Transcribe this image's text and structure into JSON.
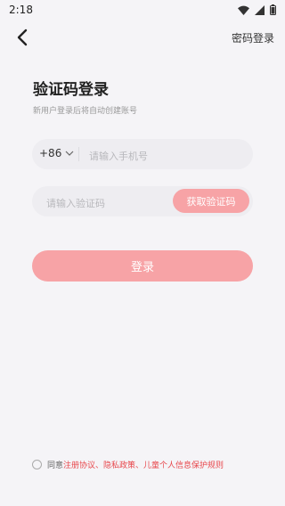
{
  "status": {
    "time": "2:18"
  },
  "nav": {
    "password_login": "密码登录"
  },
  "header": {
    "title": "验证码登录",
    "subtitle": "新用户登录后将自动创建账号"
  },
  "phone": {
    "country_code": "+86",
    "placeholder": "请输入手机号"
  },
  "code": {
    "placeholder": "请输入验证码",
    "get_code_label": "获取验证码"
  },
  "login": {
    "label": "登录"
  },
  "agreement": {
    "prefix": "同意",
    "links": "注册协议、隐私政策、儿童个人信息保护规则"
  },
  "colors": {
    "accent": "#f7a3a6",
    "link": "#e8474c",
    "background": "#f5f4f7"
  }
}
